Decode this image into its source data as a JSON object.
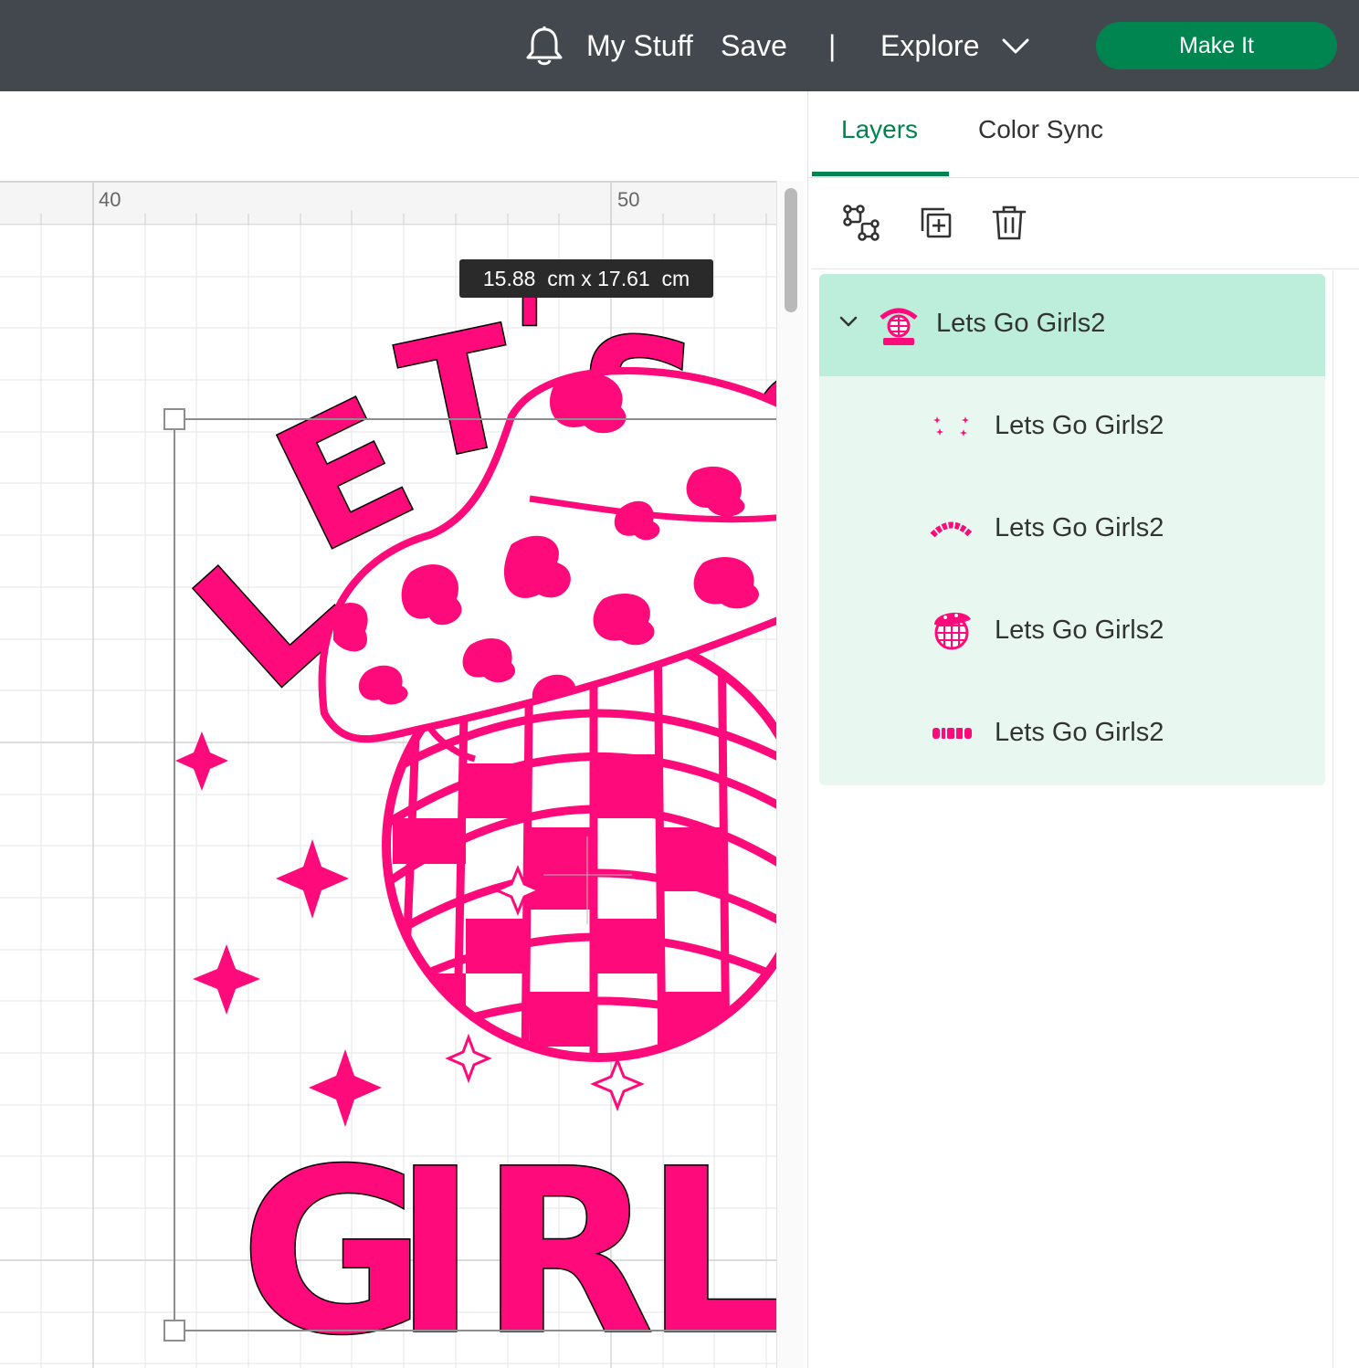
{
  "header": {
    "my_stuff": "My Stuff",
    "save": "Save",
    "separator": "|",
    "explore": "Explore",
    "make_it": "Make It",
    "icons": [
      "bell-icon",
      "chevron-down-icon"
    ]
  },
  "canvas": {
    "ruler_labels": [
      "40",
      "50"
    ],
    "size_tooltip": "15.88  cm x 17.61  cm",
    "artwork": {
      "top_text": "LET'S G",
      "bottom_text": "GIRL",
      "fill_color": "#ff0a7a"
    }
  },
  "panel": {
    "tabs": [
      {
        "label": "Layers",
        "active": true
      },
      {
        "label": "Color Sync",
        "active": false
      }
    ],
    "toolbar_icons": [
      "group-icon",
      "duplicate-icon",
      "trash-icon"
    ],
    "group": {
      "name": "Lets Go Girls2",
      "expanded": true,
      "children": [
        {
          "name": "Lets Go Girls2",
          "thumb": "sparkles"
        },
        {
          "name": "Lets Go Girls2",
          "thumb": "lets-go-text"
        },
        {
          "name": "Lets Go Girls2",
          "thumb": "hat-disco-ball"
        },
        {
          "name": "Lets Go Girls2",
          "thumb": "girls-text"
        }
      ]
    },
    "accent_color": "#008450",
    "selected_bg": "#bdeddb",
    "group_bg": "#e8f8f1"
  }
}
